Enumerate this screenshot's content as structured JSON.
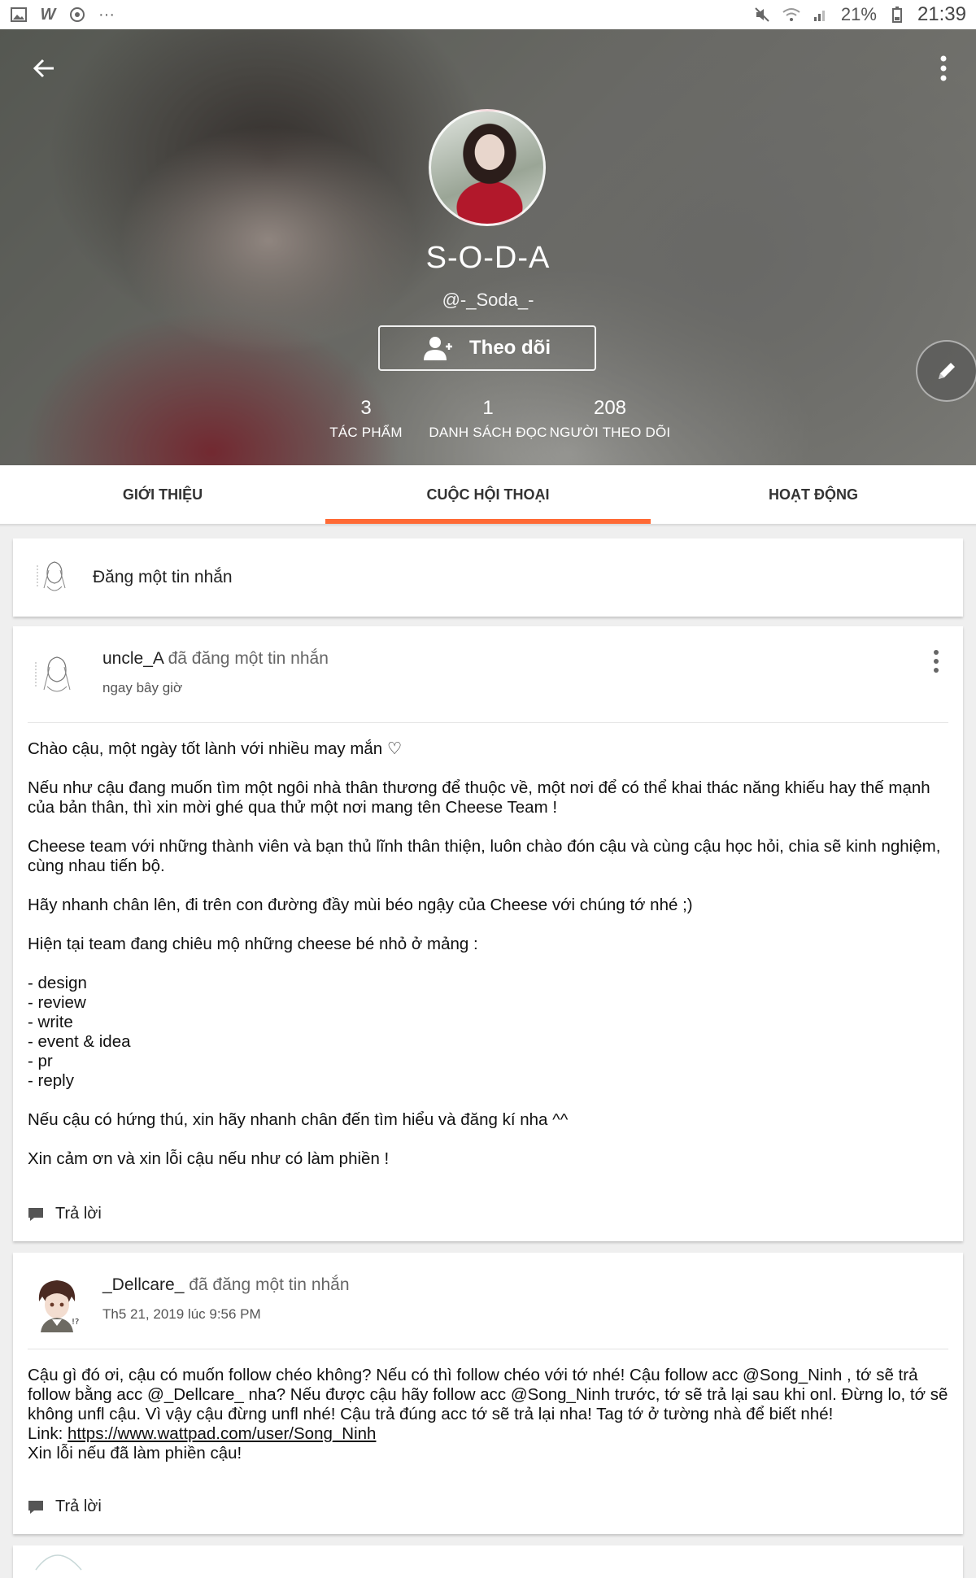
{
  "status_bar": {
    "battery": "21%",
    "time": "21:39"
  },
  "profile": {
    "name": "S-O-D-A",
    "handle": "@-_Soda_-",
    "follow_label": "Theo dõi",
    "stats": [
      {
        "value": "3",
        "label": "TÁC PHẨM"
      },
      {
        "value": "1",
        "label": "DANH SÁCH ĐỌC"
      },
      {
        "value": "208",
        "label": "NGƯỜI THEO DÕI"
      }
    ]
  },
  "tabs": [
    {
      "label": "GIỚI THIỆU"
    },
    {
      "label": "CUỘC HỘI THOẠI"
    },
    {
      "label": "HOẠT ĐỘNG"
    }
  ],
  "compose": {
    "placeholder": "Đăng một tin nhắn"
  },
  "messages": [
    {
      "author": "uncle_A",
      "action": " đã đăng một tin nhắn",
      "time": "ngay bây giờ",
      "paragraphs": [
        "Chào cậu, một ngày tốt lành với nhiều may mắn ♡",
        "Nếu như cậu đang muốn tìm một ngôi nhà thân thương để thuộc về, một nơi để có thể khai thác năng khiếu hay thế mạnh của bản thân, thì xin mời ghé qua thử một nơi mang tên Cheese Team !",
        "Cheese team với những thành viên và bạn thủ lĩnh thân thiện, luôn chào đón cậu và cùng cậu học hỏi, chia sẽ kinh nghiệm, cùng nhau tiến bộ.",
        "Hãy nhanh chân lên, đi trên con đường đầy mùi béo ngậy của Cheese với chúng tớ nhé ;)",
        "Hiện tại team đang chiêu mộ những cheese bé nhỏ ở mảng :"
      ],
      "list": [
        "- design",
        "- review",
        "- write",
        "- event & idea",
        "- pr",
        "- reply"
      ],
      "closing": [
        "Nếu cậu có hứng thú, xin hãy nhanh chân đến tìm hiểu và đăng kí nha ^^",
        "Xin cảm ơn và xin lỗi cậu nếu như có làm phiền !"
      ],
      "reply_label": "Trả lời"
    },
    {
      "author": "_Dellcare_",
      "action": " đã đăng một tin nhắn",
      "time": "Th5 21, 2019 lúc 9:56 PM",
      "body": "Cậu gì đó ơi, cậu có muốn follow chéo không? Nếu có thì follow chéo với tớ nhé! Cậu follow acc @Song_Ninh , tớ sẽ trả follow bằng acc @_Dellcare_ nha? Nếu được cậu hãy follow acc @Song_Ninh trước, tớ sẽ trả lại sau khi onl. Đừng lo, tớ sẽ không unfl cậu. Vì vậy cậu đừng unfl nhé! Cậu trả đúng acc tớ sẽ trả lại nha! Tag tớ ở tường nhà để biết nhé!",
      "link_prefix": "Link: ",
      "link": "https://www.wattpad.com/user/Song_Ninh",
      "footer": "Xin lỗi nếu đã làm phiền cậu!",
      "reply_label": "Trả lời"
    }
  ],
  "colors": {
    "accent": "#ff6a35"
  }
}
